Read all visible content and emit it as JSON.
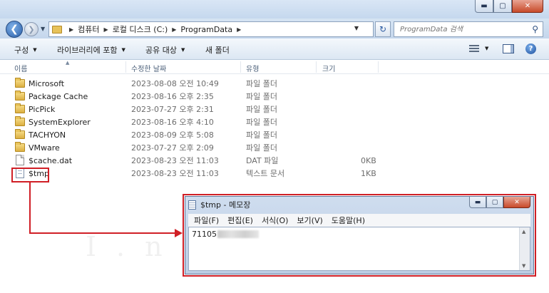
{
  "explorer": {
    "address_crumbs": [
      "컴퓨터",
      "로컬 디스크 (C:)",
      "ProgramData"
    ],
    "search_placeholder": "ProgramData 검색",
    "toolbar": {
      "organize": "구성",
      "include_in_library": "라이브러리에 포함",
      "share_with": "공유 대상",
      "new_folder": "새 폴더"
    },
    "columns": {
      "name": "이름",
      "date_modified": "수정한 날짜",
      "type": "유형",
      "size": "크기"
    },
    "files": [
      {
        "name": "Microsoft",
        "date": "2023-08-08 오전 10:49",
        "type": "파일 폴더",
        "size": "",
        "icon": "folder-icon"
      },
      {
        "name": "Package Cache",
        "date": "2023-08-16 오후 2:35",
        "type": "파일 폴더",
        "size": "",
        "icon": "folder-icon"
      },
      {
        "name": "PicPick",
        "date": "2023-07-27 오후 2:31",
        "type": "파일 폴더",
        "size": "",
        "icon": "folder-icon"
      },
      {
        "name": "SystemExplorer",
        "date": "2023-08-16 오후 4:10",
        "type": "파일 폴더",
        "size": "",
        "icon": "folder-icon"
      },
      {
        "name": "TACHYON",
        "date": "2023-08-09 오후 5:08",
        "type": "파일 폴더",
        "size": "",
        "icon": "folder-icon"
      },
      {
        "name": "VMware",
        "date": "2023-07-27 오후 2:09",
        "type": "파일 폴더",
        "size": "",
        "icon": "folder-icon"
      },
      {
        "name": "$cache.dat",
        "date": "2023-08-23 오전 11:03",
        "type": "DAT 파일",
        "size": "0KB",
        "icon": "file-icon"
      },
      {
        "name": "$tmp",
        "date": "2023-08-23 오전 11:03",
        "type": "텍스트 문서",
        "size": "1KB",
        "icon": "text-file-icon"
      }
    ]
  },
  "notepad": {
    "title": "$tmp - 메모장",
    "menu": [
      "파일(F)",
      "편집(E)",
      "서식(O)",
      "보기(V)",
      "도움말(H)"
    ],
    "content_visible": "71105"
  },
  "watermark": "I.n.t.e.r.n.e.t",
  "colors": {
    "highlight": "#d01f26"
  }
}
